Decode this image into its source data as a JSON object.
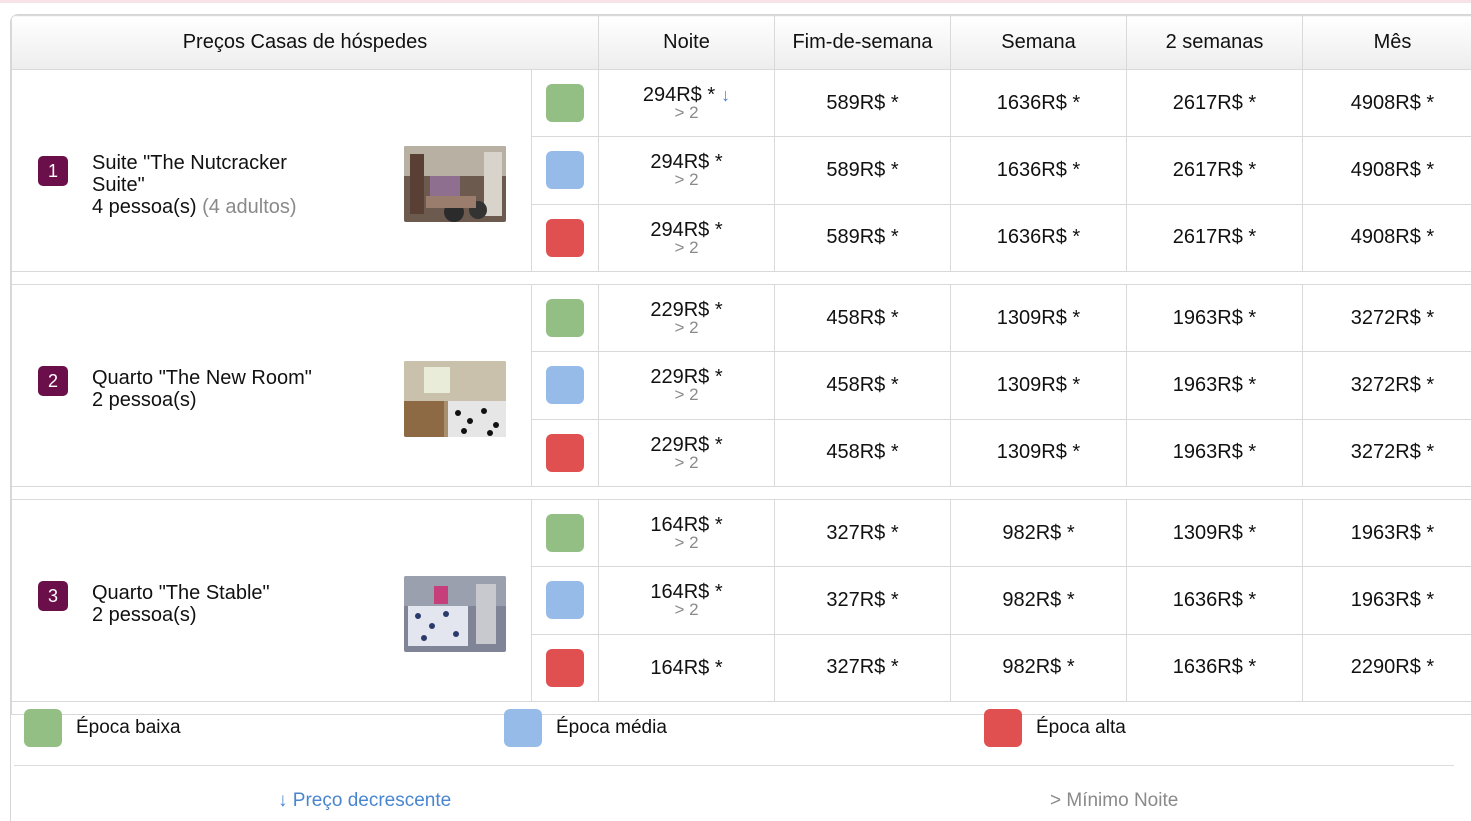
{
  "header": {
    "title": "Preços Casas de hóspedes",
    "cols": [
      "Noite",
      "Fim-de-semana",
      "Semana",
      "2 semanas",
      "Mês"
    ]
  },
  "colors": {
    "low": "#93bf85",
    "mid": "#97bbe9",
    "high": "#e05050",
    "badge": "#6b0f4a",
    "link": "#4a86cf"
  },
  "rooms": [
    {
      "num": "1",
      "name": "Suite \"The Nutcracker Suite\"",
      "people": "4 pessoa(s)",
      "extra": "(4 adultos)",
      "rows": [
        {
          "night": "294R$ *",
          "min": "> 2",
          "sort_icon": "↓",
          "weekend": "589R$ *",
          "week": "1636R$ *",
          "two_weeks": "2617R$ *",
          "month": "4908R$ *"
        },
        {
          "night": "294R$ *",
          "min": "> 2",
          "weekend": "589R$ *",
          "week": "1636R$ *",
          "two_weeks": "2617R$ *",
          "month": "4908R$ *"
        },
        {
          "night": "294R$ *",
          "min": "> 2",
          "weekend": "589R$ *",
          "week": "1636R$ *",
          "two_weeks": "2617R$ *",
          "month": "4908R$ *"
        }
      ]
    },
    {
      "num": "2",
      "name": "Quarto \"The New Room\"",
      "people": "2 pessoa(s)",
      "rows": [
        {
          "night": "229R$ *",
          "min": "> 2",
          "weekend": "458R$ *",
          "week": "1309R$ *",
          "two_weeks": "1963R$ *",
          "month": "3272R$ *"
        },
        {
          "night": "229R$ *",
          "min": "> 2",
          "weekend": "458R$ *",
          "week": "1309R$ *",
          "two_weeks": "1963R$ *",
          "month": "3272R$ *"
        },
        {
          "night": "229R$ *",
          "min": "> 2",
          "weekend": "458R$ *",
          "week": "1309R$ *",
          "two_weeks": "1963R$ *",
          "month": "3272R$ *"
        }
      ]
    },
    {
      "num": "3",
      "name": "Quarto \"The Stable\"",
      "people": "2 pessoa(s)",
      "rows": [
        {
          "night": "164R$ *",
          "min": "> 2",
          "weekend": "327R$ *",
          "week": "982R$ *",
          "two_weeks": "1309R$ *",
          "month": "1963R$ *"
        },
        {
          "night": "164R$ *",
          "min": "> 2",
          "weekend": "327R$ *",
          "week": "982R$ *",
          "two_weeks": "1636R$ *",
          "month": "1963R$ *"
        },
        {
          "night": "164R$ *",
          "weekend": "327R$ *",
          "week": "982R$ *",
          "two_weeks": "1636R$ *",
          "month": "2290R$ *"
        }
      ]
    }
  ],
  "legend": {
    "low": "Época baixa",
    "mid": "Época média",
    "high": "Época alta",
    "sort_note": "↓ Preço decrescente",
    "min_note": "> Mínimo Noite"
  }
}
